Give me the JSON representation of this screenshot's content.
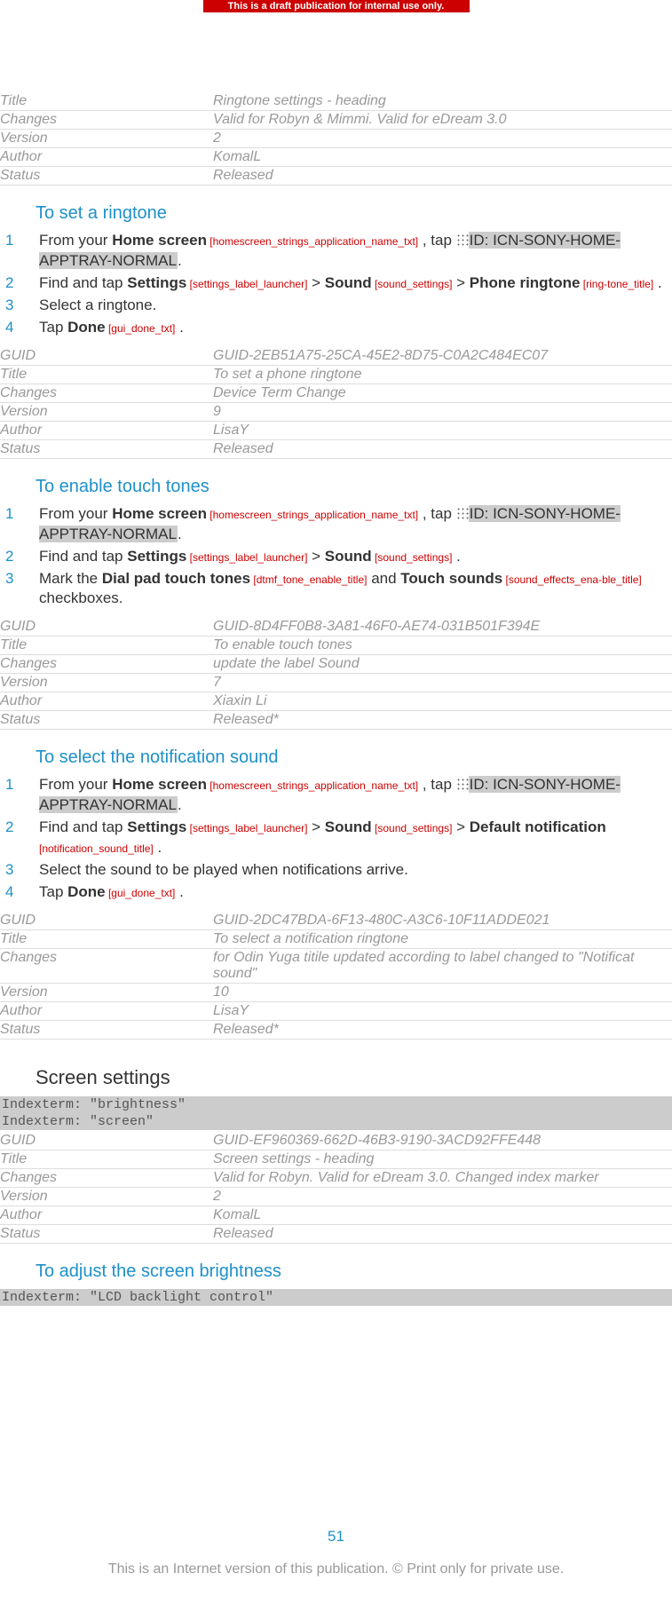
{
  "banner": "This is a draft publication for internal use only.",
  "meta_top": {
    "rows": [
      {
        "k": "Title",
        "v": "Ringtone settings - heading"
      },
      {
        "k": "Changes",
        "v": "Valid for Robyn & Mimmi. Valid for eDream 3.0"
      },
      {
        "k": "Version",
        "v": "2"
      },
      {
        "k": "Author",
        "v": "KomalL"
      },
      {
        "k": "Status",
        "v": "Released"
      }
    ]
  },
  "sec1": {
    "title": "To set a ringtone",
    "step1_a": "From your ",
    "step1_b": "Home screen",
    "step1_ref1": " [homescreen_strings_application_name_txt]",
    "step1_c": " , tap ",
    "step1_d": "ID: ICN-SONY-HOME-APPTRAY-NORMAL",
    "step1_e": ".",
    "step2_a": "Find and tap ",
    "step2_b": "Settings",
    "step2_ref1": " [settings_label_launcher]",
    "step2_c": " > ",
    "step2_d": "Sound",
    "step2_ref2": " [sound_settings]",
    "step2_e": " > ",
    "step2_f": "Phone ringtone",
    "step2_ref3": " [ring-tone_title]",
    "step2_g": " .",
    "step3": "Select a ringtone.",
    "step4_a": "Tap ",
    "step4_b": "Done",
    "step4_ref": " [gui_done_txt]",
    "step4_c": " ."
  },
  "meta1": {
    "rows": [
      {
        "k": "GUID",
        "v": "GUID-2EB51A75-25CA-45E2-8D75-C0A2C484EC07"
      },
      {
        "k": "Title",
        "v": "To set a phone ringtone"
      },
      {
        "k": "Changes",
        "v": "Device Term Change"
      },
      {
        "k": "Version",
        "v": "9"
      },
      {
        "k": "Author",
        "v": "LisaY"
      },
      {
        "k": "Status",
        "v": "Released"
      }
    ]
  },
  "sec2": {
    "title": "To enable touch tones",
    "step1_a": "From your ",
    "step1_b": "Home screen",
    "step1_ref1": " [homescreen_strings_application_name_txt]",
    "step1_c": " , tap ",
    "step1_d": "ID: ICN-SONY-HOME-APPTRAY-NORMAL",
    "step1_e": ".",
    "step2_a": "Find and tap ",
    "step2_b": "Settings",
    "step2_ref1": " [settings_label_launcher]",
    "step2_c": " > ",
    "step2_d": "Sound",
    "step2_ref2": " [sound_settings]",
    "step2_e": " .",
    "step3_a": "Mark the ",
    "step3_b": "Dial pad touch tones",
    "step3_ref1": " [dtmf_tone_enable_title]",
    "step3_c": " and ",
    "step3_d": "Touch sounds",
    "step3_ref2": " [sound_effects_ena-ble_title]",
    "step3_e": " checkboxes."
  },
  "meta2": {
    "rows": [
      {
        "k": "GUID",
        "v": "GUID-8D4FF0B8-3A81-46F0-AE74-031B501F394E"
      },
      {
        "k": "Title",
        "v": "To enable touch tones"
      },
      {
        "k": "Changes",
        "v": "update the label Sound"
      },
      {
        "k": "Version",
        "v": "7"
      },
      {
        "k": "Author",
        "v": "Xiaxin Li"
      },
      {
        "k": "Status",
        "v": "Released*"
      }
    ]
  },
  "sec3": {
    "title": "To select the notification sound",
    "step1_a": "From your ",
    "step1_b": "Home screen",
    "step1_ref1": " [homescreen_strings_application_name_txt]",
    "step1_c": " , tap ",
    "step1_d": "ID: ICN-SONY-HOME-APPTRAY-NORMAL",
    "step1_e": ".",
    "step2_a": "Find and tap ",
    "step2_b": "Settings",
    "step2_ref1": " [settings_label_launcher]",
    "step2_c": " > ",
    "step2_d": "Sound",
    "step2_ref2": " [sound_settings]",
    "step2_e": " > ",
    "step2_f": "Default notification",
    "step2_ref3": " [notification_sound_title]",
    "step2_g": " .",
    "step3": "Select the sound to be played when notifications arrive.",
    "step4_a": "Tap ",
    "step4_b": "Done",
    "step4_ref": " [gui_done_txt]",
    "step4_c": " ."
  },
  "meta3": {
    "rows": [
      {
        "k": "GUID",
        "v": "GUID-2DC47BDA-6F13-480C-A3C6-10F11ADDE021"
      },
      {
        "k": "Title",
        "v": "To select a notification ringtone"
      },
      {
        "k": "Changes",
        "v": "for Odin Yuga titile updated according to label changed to \"Notificat sound\""
      },
      {
        "k": "Version",
        "v": "10"
      },
      {
        "k": "Author",
        "v": "LisaY"
      },
      {
        "k": "Status",
        "v": "Released*"
      }
    ]
  },
  "screen_heading": "Screen settings",
  "indexterm_brightness": "Indexterm: \"brightness\"",
  "indexterm_screen": "Indexterm: \"screen\"",
  "meta4": {
    "rows": [
      {
        "k": "GUID",
        "v": "GUID-EF960369-662D-46B3-9190-3ACD92FFE448"
      },
      {
        "k": "Title",
        "v": "Screen settings - heading"
      },
      {
        "k": "Changes",
        "v": "Valid for Robyn. Valid for eDream 3.0. Changed index marker"
      },
      {
        "k": "Version",
        "v": "2"
      },
      {
        "k": "Author",
        "v": "KomalL"
      },
      {
        "k": "Status",
        "v": "Released"
      }
    ]
  },
  "sec4": {
    "title": "To adjust the screen brightness"
  },
  "indexterm_lcd": "Indexterm: \"LCD backlight control\"",
  "pagenum": "51",
  "footer": "This is an Internet version of this publication. © Print only for private use."
}
